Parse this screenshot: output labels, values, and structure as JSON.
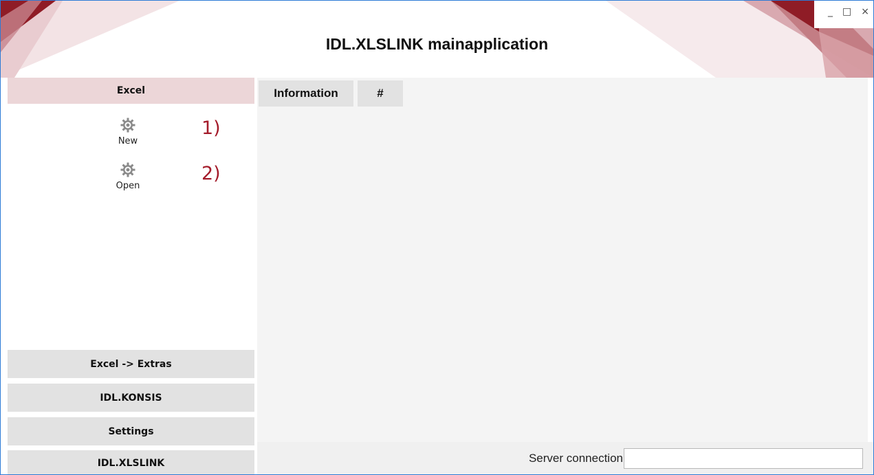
{
  "window": {
    "title": "IDL.XLSLINK mainapplication",
    "controls": {
      "minimize": "_",
      "maximize": "□",
      "close": "×"
    },
    "colors": {
      "accent": "#a41c2b",
      "border": "#2b7bd6",
      "sidebar_header_bg": "#ecd6d8"
    }
  },
  "sidebar": {
    "header": "Excel",
    "tools": [
      {
        "label": "New",
        "icon": "gear-icon",
        "step": "1)"
      },
      {
        "label": "Open",
        "icon": "gear-icon",
        "step": "2)"
      }
    ],
    "sections": [
      "Excel -> Extras",
      "IDL.KONSIS",
      "Settings",
      "IDL.XLSLINK"
    ]
  },
  "main": {
    "tabs": [
      "Information",
      "#"
    ]
  },
  "status": {
    "server_label": "Server connection",
    "server_value": ""
  }
}
